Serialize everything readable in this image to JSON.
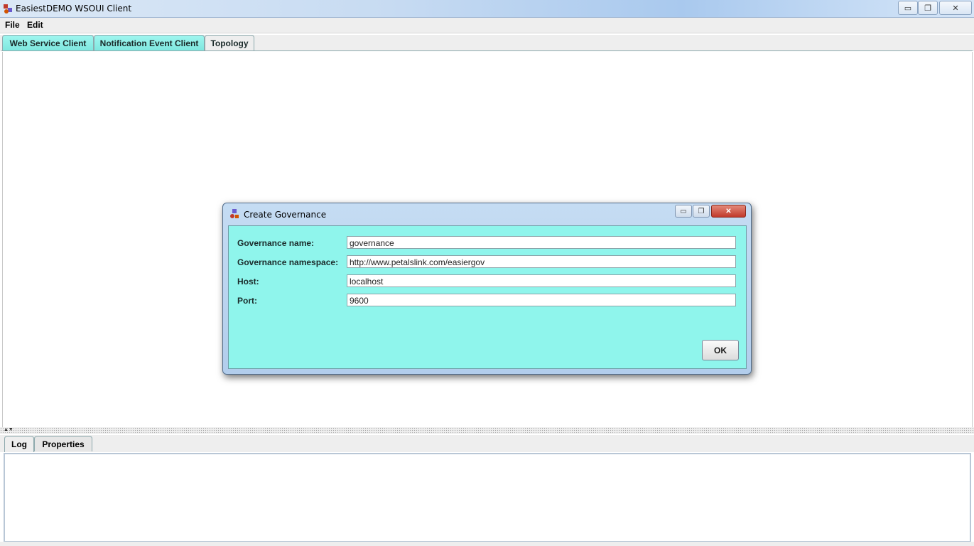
{
  "window": {
    "title": "EasiestDEMO WSOUI Client",
    "minimize_label": "▭",
    "maximize_label": "❐",
    "close_label": "✕"
  },
  "menu": {
    "file": "File",
    "edit": "Edit"
  },
  "top_tabs": [
    {
      "label": "Web Service Client",
      "active": false
    },
    {
      "label": "Notification Event Client",
      "active": false
    },
    {
      "label": "Topology",
      "active": true
    }
  ],
  "bottom_tabs": [
    {
      "label": "Log",
      "active": true
    },
    {
      "label": "Properties",
      "active": false
    }
  ],
  "dialog": {
    "title": "Create Governance",
    "minimize_label": "▭",
    "maximize_label": "❐",
    "close_label": "✕",
    "fields": [
      {
        "label": "Governance name:",
        "value": "governance"
      },
      {
        "label": "Governance namespace:",
        "value": "http://www.petalslink.com/easiergov"
      },
      {
        "label": "Host:",
        "value": "localhost"
      },
      {
        "label": "Port:",
        "value": "9600"
      }
    ],
    "ok_label": "OK"
  },
  "colors": {
    "accent_tab": "#8ff5ec",
    "dialog_content": "#8ff5ec",
    "titlebar": "#c7dbf2"
  },
  "icons": {
    "app": "app-logo-icon",
    "dialog": "app-logo-icon"
  }
}
